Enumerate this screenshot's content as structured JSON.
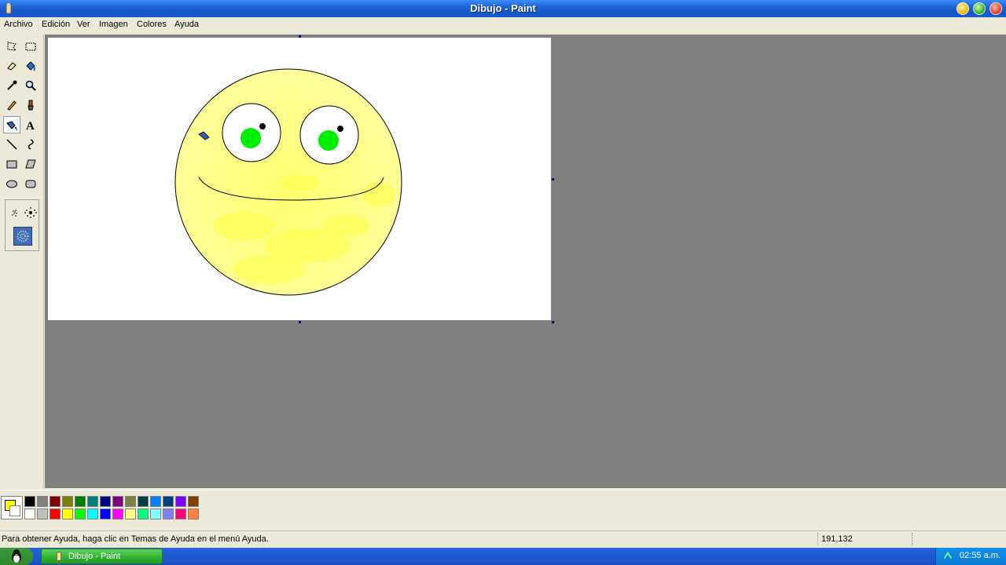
{
  "window": {
    "title": "Dibujo - Paint"
  },
  "menu": [
    "Archivo",
    "Edición",
    "Ver",
    "Imagen",
    "Colores",
    "Ayuda"
  ],
  "tools": [
    "free-select",
    "rect-select",
    "eraser",
    "fill-bucket",
    "color-picker",
    "magnifier",
    "pencil",
    "brush",
    "airbrush",
    "text",
    "line",
    "curve",
    "rectangle",
    "polygon",
    "ellipse",
    "rounded-rectangle"
  ],
  "active_tool": "airbrush",
  "palette": {
    "foreground": "#ffff00",
    "background": "#ffffff",
    "colors": [
      "#000000",
      "#808080",
      "#800000",
      "#808000",
      "#008000",
      "#008080",
      "#000080",
      "#800080",
      "#808040",
      "#004040",
      "#0080ff",
      "#004080",
      "#8000ff",
      "#804000",
      "#ffffff",
      "#c0c0c0",
      "#ff0000",
      "#ffff00",
      "#00ff00",
      "#00ffff",
      "#0000ff",
      "#ff00ff",
      "#ffff80",
      "#00ff80",
      "#80ffff",
      "#8080ff",
      "#ff0080",
      "#ff8040"
    ]
  },
  "canvas": {
    "face_color": "#ffff99",
    "eye_color": "#00ee00"
  },
  "status": {
    "message": "Para obtener Ayuda, haga clic en Temas de Ayuda en el menú Ayuda.",
    "coords": "191,132"
  },
  "taskbar": {
    "task_label": "Dibujo - Paint",
    "clock": "02:55 a.m."
  }
}
